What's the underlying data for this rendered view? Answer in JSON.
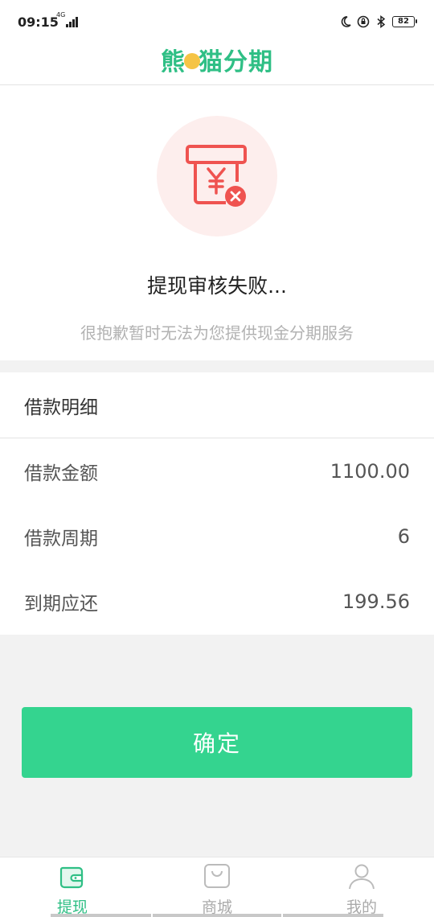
{
  "status": {
    "time": "09:15",
    "network": "4G",
    "battery": "82"
  },
  "header": {
    "logo_part1": "熊",
    "logo_part2": "猫",
    "logo_part3": "分期"
  },
  "result": {
    "icon": "receipt-yen-fail-icon",
    "title": "提现审核失败...",
    "description": "很抱歉暂时无法为您提供现金分期服务"
  },
  "details": {
    "header": "借款明细",
    "rows": [
      {
        "label": "借款金额",
        "value": "1100.00"
      },
      {
        "label": "借款周期",
        "value": "6"
      },
      {
        "label": "到期应还",
        "value": "199.56"
      }
    ]
  },
  "confirm_label": "确定",
  "tabs": [
    {
      "label": "提现",
      "icon": "wallet-icon",
      "active": true
    },
    {
      "label": "商城",
      "icon": "shopping-bag-icon",
      "active": false
    },
    {
      "label": "我的",
      "icon": "user-icon",
      "active": false
    }
  ],
  "colors": {
    "brand": "#2fbf85",
    "button": "#34d48f",
    "error": "#ef5350"
  }
}
